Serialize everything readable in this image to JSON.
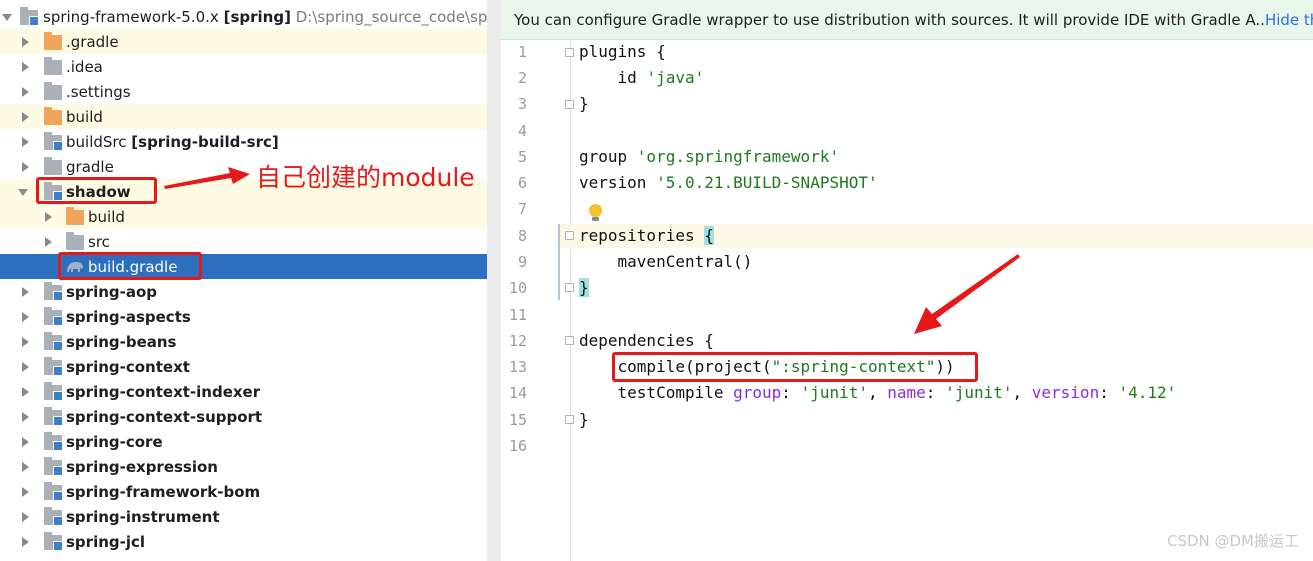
{
  "tree": {
    "root": {
      "name": "spring-framework-5.0.x",
      "module": "[spring]",
      "path": "D:\\spring_source_code\\spring"
    },
    "items": [
      {
        "label": ".gradle",
        "bold": false
      },
      {
        "label": ".idea",
        "bold": false
      },
      {
        "label": ".settings",
        "bold": false
      },
      {
        "label": "build",
        "bold": false
      },
      {
        "label": "buildSrc",
        "module": "[spring-build-src]"
      },
      {
        "label": "gradle",
        "bold": false
      },
      {
        "label": "shadow",
        "bold": true
      },
      {
        "label": "build",
        "bold": false
      },
      {
        "label": "src",
        "bold": false
      },
      {
        "label": "build.gradle",
        "bold": false
      },
      {
        "label": "spring-aop",
        "bold": true
      },
      {
        "label": "spring-aspects",
        "bold": true
      },
      {
        "label": "spring-beans",
        "bold": true
      },
      {
        "label": "spring-context",
        "bold": true
      },
      {
        "label": "spring-context-indexer",
        "bold": true
      },
      {
        "label": "spring-context-support",
        "bold": true
      },
      {
        "label": "spring-core",
        "bold": true
      },
      {
        "label": "spring-expression",
        "bold": true
      },
      {
        "label": "spring-framework-bom",
        "bold": true
      },
      {
        "label": "spring-instrument",
        "bold": true
      },
      {
        "label": "spring-jcl",
        "bold": true
      }
    ]
  },
  "annotation": "自己创建的module",
  "notification": {
    "text": "You can configure Gradle wrapper to use distribution with sources. It will provide IDE with Gradle A..",
    "link": "Hide the ti"
  },
  "editor": {
    "line_numbers": [
      "1",
      "2",
      "3",
      "4",
      "5",
      "6",
      "7",
      "8",
      "9",
      "10",
      "11",
      "12",
      "13",
      "14",
      "15",
      "16"
    ],
    "lines": {
      "l1": "plugins {",
      "l2a": "    id ",
      "l2b": "'java'",
      "l3": "}",
      "l5a": "group ",
      "l5b": "'org.springframework'",
      "l6a": "version ",
      "l6b": "'5.0.21.BUILD-SNAPSHOT'",
      "l8a": "repositories ",
      "l8b": "{",
      "l9": "    mavenCentral()",
      "l10": "}",
      "l12": "dependencies {",
      "l13a": "    compile(project(",
      "l13b": "\":spring-context\"",
      "l13c": "))",
      "l14a": "    testCompile ",
      "l14b": "group",
      "l14c": ": ",
      "l14d": "'junit'",
      "l14e": ", ",
      "l14f": "name",
      "l14g": ": ",
      "l14h": "'junit'",
      "l14i": ", ",
      "l14j": "version",
      "l14k": ": ",
      "l14l": "'4.12'",
      "l15": "}"
    }
  },
  "watermark": "CSDN @DM搬运工",
  "colors": {
    "selection": "#2d6fbf",
    "annotation_red": "#e5191a",
    "string_green": "#1f7a1f"
  }
}
